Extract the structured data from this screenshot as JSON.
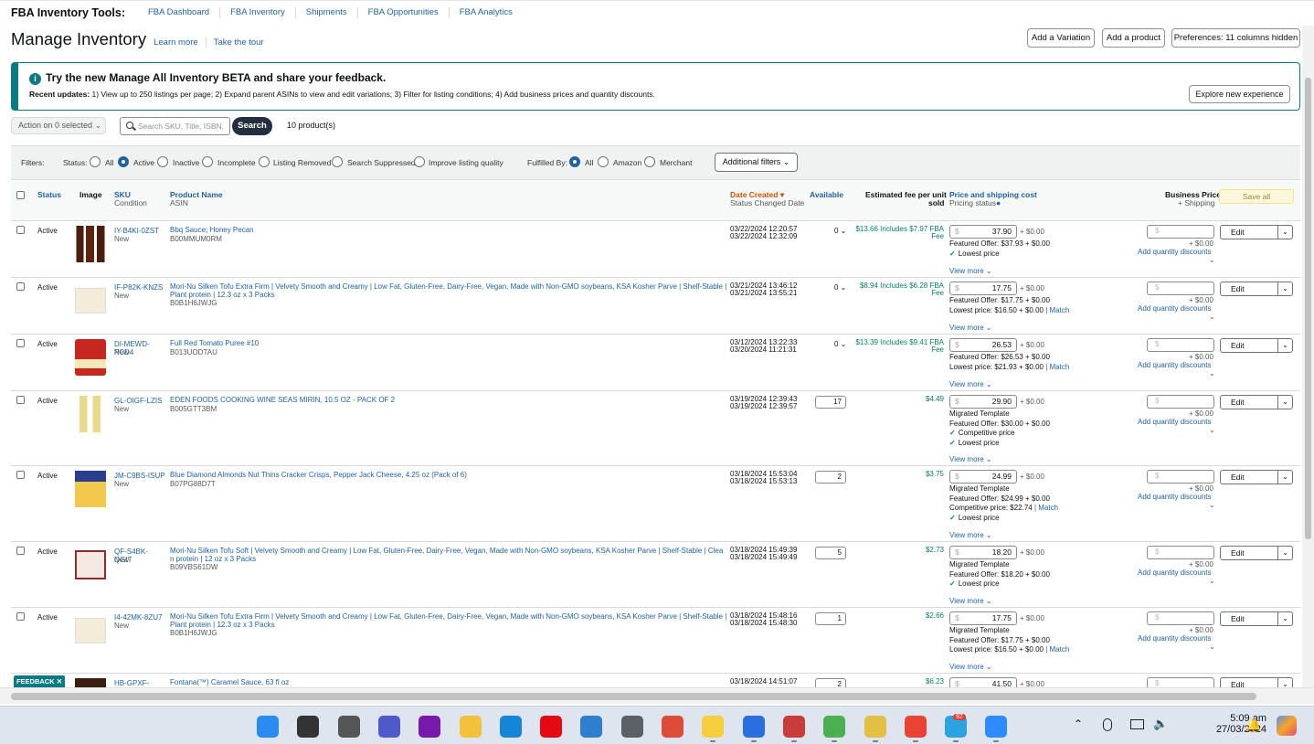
{
  "nav": {
    "brand": "FBA Inventory Tools:",
    "links": [
      "FBA Dashboard",
      "FBA Inventory",
      "Shipments",
      "FBA Opportunities",
      "FBA Analytics"
    ]
  },
  "header": {
    "title": "Manage Inventory",
    "learn_more": "Learn more",
    "take_tour": "Take the tour",
    "add_variation": "Add a Variation",
    "add_product": "Add a product",
    "preferences": "Preferences: 11 columns hidden"
  },
  "banner": {
    "icon": "i",
    "title": "Try the new Manage All Inventory BETA and share your feedback.",
    "updates_label": "Recent updates:",
    "updates_text": " 1) View up to 250 listings per page; 2) Expand parent ASINs to view and edit variations; 3) Filter for listing conditions; 4) Add business prices and quantity discounts.",
    "explore": "Explore new experience"
  },
  "actions": {
    "action_select": "Action on 0 selected",
    "search_placeholder": "Search SKU, Title, ISBN,",
    "search_button": "Search",
    "product_count": "10 product(s)"
  },
  "filters": {
    "label": "Filters:",
    "status_label": "Status:",
    "status_options": [
      "All",
      "Active",
      "Inactive",
      "Incomplete",
      "Listing Removed",
      "Search Suppressed",
      "Improve listing quality"
    ],
    "status_selected": "Active",
    "fulfilled_label": "Fulfilled By:",
    "fulfilled_options": [
      "All",
      "Amazon",
      "Merchant"
    ],
    "fulfilled_selected": "All",
    "additional": "Additional filters"
  },
  "columns": {
    "status": "Status",
    "image": "Image",
    "sku": "SKU",
    "condition": "Condition",
    "product_name": "Product Name",
    "asin": "ASIN",
    "date_created": "Date Created",
    "status_changed": "Status Changed Date",
    "available": "Available",
    "fee_l1": "Estimated fee per unit",
    "fee_l2": "sold",
    "price": "Price and shipping cost",
    "pricing_status": "Pricing status",
    "business_price": "Business Price",
    "plus_shipping": "+ Shipping",
    "save_all": "Save all"
  },
  "common": {
    "plus_ship": "+ $0.00",
    "bp_ship": "+ $0.00",
    "add_qty": "Add quantity discounts",
    "view_more": "View more",
    "edit": "Edit",
    "match": "Match",
    "new": "New"
  },
  "rows": [
    {
      "status": "Active",
      "sku": "IY-B4KI-0ZST",
      "name": "Bbq Sauce; Honey Pecan",
      "asin": "B00MMUM0RM",
      "created": "03/22/2024 12:20:57",
      "changed": "03/22/2024 12:32:09",
      "available": "0",
      "fee": "$13.66 Includes $7.97 FBA",
      "fee2": "Fee",
      "price": "37.90",
      "lines": [
        {
          "text": "Featured Offer: $37.93 + $0.00"
        },
        {
          "check": true,
          "text": "Lowest price"
        }
      ]
    },
    {
      "status": "Active",
      "sku": "IF-P82K-KNZS",
      "name": "Mori-Nu Silken Tofu Extra Firm | Velvety Smooth and Creamy | Low Fat, Gluten-Free, Dairy-Free, Vegan, Made with Non-GMO soybeans, KSA Kosher Parve | Shelf-Stable | Plant protein | 12.3 oz x 3 Packs",
      "asin": "B0B1H6JWJG",
      "created": "03/21/2024 13:46:12",
      "changed": "03/21/2024 13:55:21",
      "available": "0",
      "fee": "$8.94 Includes $6.28 FBA",
      "fee2": "Fee",
      "price": "17.75",
      "lines": [
        {
          "text": "Featured Offer: $17.75 + $0.00"
        },
        {
          "text": "Lowest price: $16.50 + $0.00",
          "match": true
        }
      ]
    },
    {
      "status": "Active",
      "sku": "DI-MEWD-PCD4",
      "name": "Full Red Tomato Puree #10",
      "asin": "B013UODTAU",
      "created": "03/12/2024 13:22:33",
      "changed": "03/20/2024 11:21:31",
      "available": "0",
      "fee": "$13.39 Includes $9.41 FBA",
      "fee2": "Fee",
      "price": "26.53",
      "lines": [
        {
          "text": "Featured Offer: $26.53 + $0.00"
        },
        {
          "text": "Lowest price: $21.93 + $0.00",
          "match": true
        }
      ]
    },
    {
      "status": "Active",
      "sku": "GL-OIGF-LZIS",
      "name": "EDEN FOODS COOKING WINE SEAS MIRIN, 10.5 OZ - PACK OF 2",
      "asin": "B005GTT3BM",
      "created": "03/19/2024 12:39:43",
      "changed": "03/19/2024 12:39:57",
      "available": "17",
      "fee": "$4.49",
      "fee2": "",
      "price": "29.90",
      "lines": [
        {
          "text": "Migrated Template"
        },
        {
          "text": "Featured Offer: $30.00 + $0.00"
        },
        {
          "check": true,
          "text": "Competitive price"
        },
        {
          "check": true,
          "text": "Lowest price"
        }
      ]
    },
    {
      "status": "Active",
      "sku": "JM-C9BS-ISUP",
      "name": "Blue Diamond Almonds Nut Thins Cracker Crisps, Pepper Jack Cheese, 4.25 oz (Pack of 6)",
      "asin": "B07PG88D7T",
      "created": "03/18/2024 15:53:04",
      "changed": "03/18/2024 15:53:13",
      "available": "2",
      "fee": "$3.75",
      "fee2": "",
      "price": "24.99",
      "lines": [
        {
          "text": "Migrated Template"
        },
        {
          "text": "Featured Offer: $24.99 + $0.00"
        },
        {
          "text": "Competitive price: $22.74",
          "match": true
        },
        {
          "check": true,
          "text": "Lowest price"
        }
      ]
    },
    {
      "status": "Active",
      "sku": "QF-S4BK-QGIT",
      "name": "Mori-Nu Silken Tofu Soft | Velvety Smooth and Creamy | Low Fat, Gluten-Free, Dairy-Free, Vegan, Made with Non-GMO soybeans, KSA Kosher Parve | Shelf-Stable | Clea n protein | 12 oz x 3 Packs",
      "asin": "B09VBS61DW",
      "created": "03/18/2024 15:49:39",
      "changed": "03/18/2024 15:49:49",
      "available": "5",
      "fee": "$2.73",
      "fee2": "",
      "price": "18.20",
      "lines": [
        {
          "text": "Migrated Template"
        },
        {
          "text": "Featured Offer: $18.20 + $0.00"
        },
        {
          "check": true,
          "text": "Lowest price"
        }
      ]
    },
    {
      "status": "Active",
      "sku": "I4-42MK-8ZU7",
      "name": "Mori-Nu Silken Tofu Extra Firm | Velvety Smooth and Creamy | Low Fat, Gluten-Free, Dairy-Free, Vegan, Made with Non-GMO soybeans, KSA Kosher Parve | Shelf-Stable | Plant protein | 12.3 oz x 3 Packs",
      "asin": "B0B1H6JWJG",
      "created": "03/18/2024 15:48:16",
      "changed": "03/18/2024 15:48:30",
      "available": "1",
      "fee": "$2.66",
      "fee2": "",
      "price": "17.75",
      "lines": [
        {
          "text": "Migrated Template"
        },
        {
          "text": "Featured Offer: $17.75 + $0.00"
        },
        {
          "text": "Lowest price: $16.50 + $0.00",
          "match": true
        }
      ]
    },
    {
      "status": "",
      "sku": "HB-GPXF-",
      "name": "Fontana(™) Caramel Sauce, 63 fl oz",
      "asin": "",
      "created": "03/18/2024 14:51:07",
      "changed": "",
      "available": "2",
      "fee": "$6.23",
      "fee2": "",
      "price": "41.50",
      "lines": []
    }
  ],
  "feedback": "FEEDBACK ✕",
  "clock": {
    "time": "5:09 am",
    "date": "27/03/2024"
  },
  "taskbar": {
    "badge": "92",
    "icons": [
      "start-icon",
      "search-icon",
      "task-view-icon",
      "teams-icon",
      "onenote-icon",
      "file-explorer-icon",
      "edge-icon",
      "netflix-icon",
      "notepad-icon",
      "calculator-icon",
      "chrome-icon",
      "sticky-notes-icon",
      "remote-desktop-icon",
      "snipping-tool-icon",
      "chrome-profile-icon",
      "chrome-profile-icon",
      "chrome-profile-icon",
      "telegram-icon",
      "zoom-icon"
    ]
  },
  "colors": {
    "accent": "#0a7b83",
    "link": "#2162a1",
    "check": "#067d62",
    "sort": "#c45500"
  }
}
